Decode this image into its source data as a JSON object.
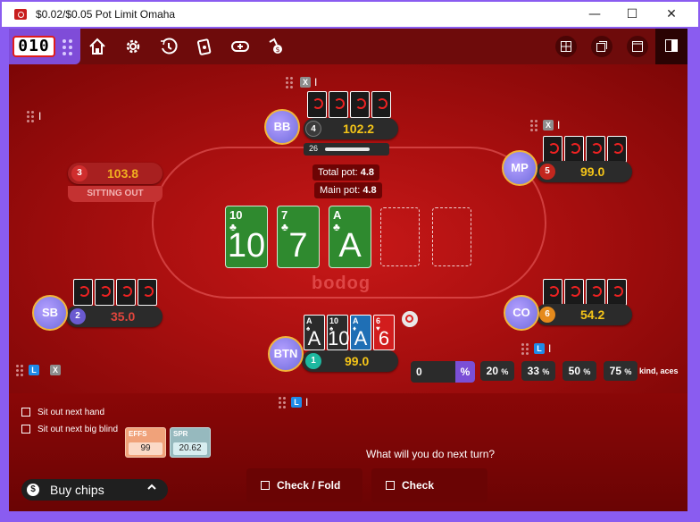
{
  "window": {
    "title": "$0.02/$0.05 Pot Limit Omaha",
    "minimize_glyph": "—",
    "maximize_glyph": "☐",
    "close_glyph": "✕"
  },
  "toolbar": {
    "timer": "010",
    "icons": [
      "home-icon",
      "settings-icon",
      "history-icon",
      "cards-icon",
      "add-chips-icon",
      "rebuy-icon"
    ],
    "right_icons": [
      "grid-icon",
      "tables-icon",
      "window-icon",
      "layout-icon"
    ]
  },
  "seats": {
    "bb": {
      "position": "BB",
      "seat": "4",
      "stack": "102.2",
      "timer": "26",
      "timer_fraction": 0.75
    },
    "mp": {
      "position": "MP",
      "seat": "5",
      "stack": "99.0"
    },
    "sitting_out": {
      "seat": "3",
      "stack": "103.8",
      "status": "SITTING OUT"
    },
    "sb": {
      "position": "SB",
      "seat": "2",
      "stack": "35.0"
    },
    "co": {
      "position": "CO",
      "seat": "6",
      "stack": "54.2"
    },
    "btn": {
      "position": "BTN",
      "seat": "1",
      "stack": "99.0"
    }
  },
  "pot": {
    "total_label": "Total pot:",
    "total_value": "4.8",
    "main_label": "Main pot:",
    "main_value": "4.8"
  },
  "board": [
    {
      "rank": "10",
      "suit": "♣",
      "big": "10"
    },
    {
      "rank": "7",
      "suit": "♣",
      "big": "7"
    },
    {
      "rank": "A",
      "suit": "♣",
      "big": "A"
    }
  ],
  "hero_cards": [
    {
      "rank": "A",
      "suit": "♠",
      "big": "A",
      "color": "#2b2b2b"
    },
    {
      "rank": "10",
      "suit": "♠",
      "big": "10",
      "color": "#2b2b2b"
    },
    {
      "rank": "A",
      "suit": "♦",
      "big": "A",
      "color": "#1f6fb5"
    },
    {
      "rank": "6",
      "suit": "♥",
      "big": "6",
      "color": "#d21d1d"
    }
  ],
  "hand_strength": "kind, aces",
  "bet_sizing": {
    "input_value": "0",
    "percent_symbol": "%",
    "presets": [
      {
        "value": "20",
        "unit": "%"
      },
      {
        "value": "33",
        "unit": "%"
      },
      {
        "value": "50",
        "unit": "%"
      },
      {
        "value": "75",
        "unit": "%"
      }
    ]
  },
  "options": {
    "sit_out_next_hand": "Sit out next hand",
    "sit_out_next_bb": "Sit out next big blind"
  },
  "stats": {
    "effs_label": "EFFS",
    "effs_value": "99",
    "spr_label": "SPR",
    "spr_value": "20.62"
  },
  "prompt": "What will you do next turn?",
  "actions": {
    "check_fold": "Check / Fold",
    "check": "Check"
  },
  "buy_chips": {
    "label": "Buy chips",
    "coin_symbol": "$"
  },
  "tags": {
    "x": "X",
    "l": "L"
  },
  "brand": "bodog",
  "colors": {
    "table_red": "#c81818",
    "frame_purple": "#8a5cf0",
    "stack_yellow": "#f5c518",
    "board_green": "#2f8a2f"
  }
}
